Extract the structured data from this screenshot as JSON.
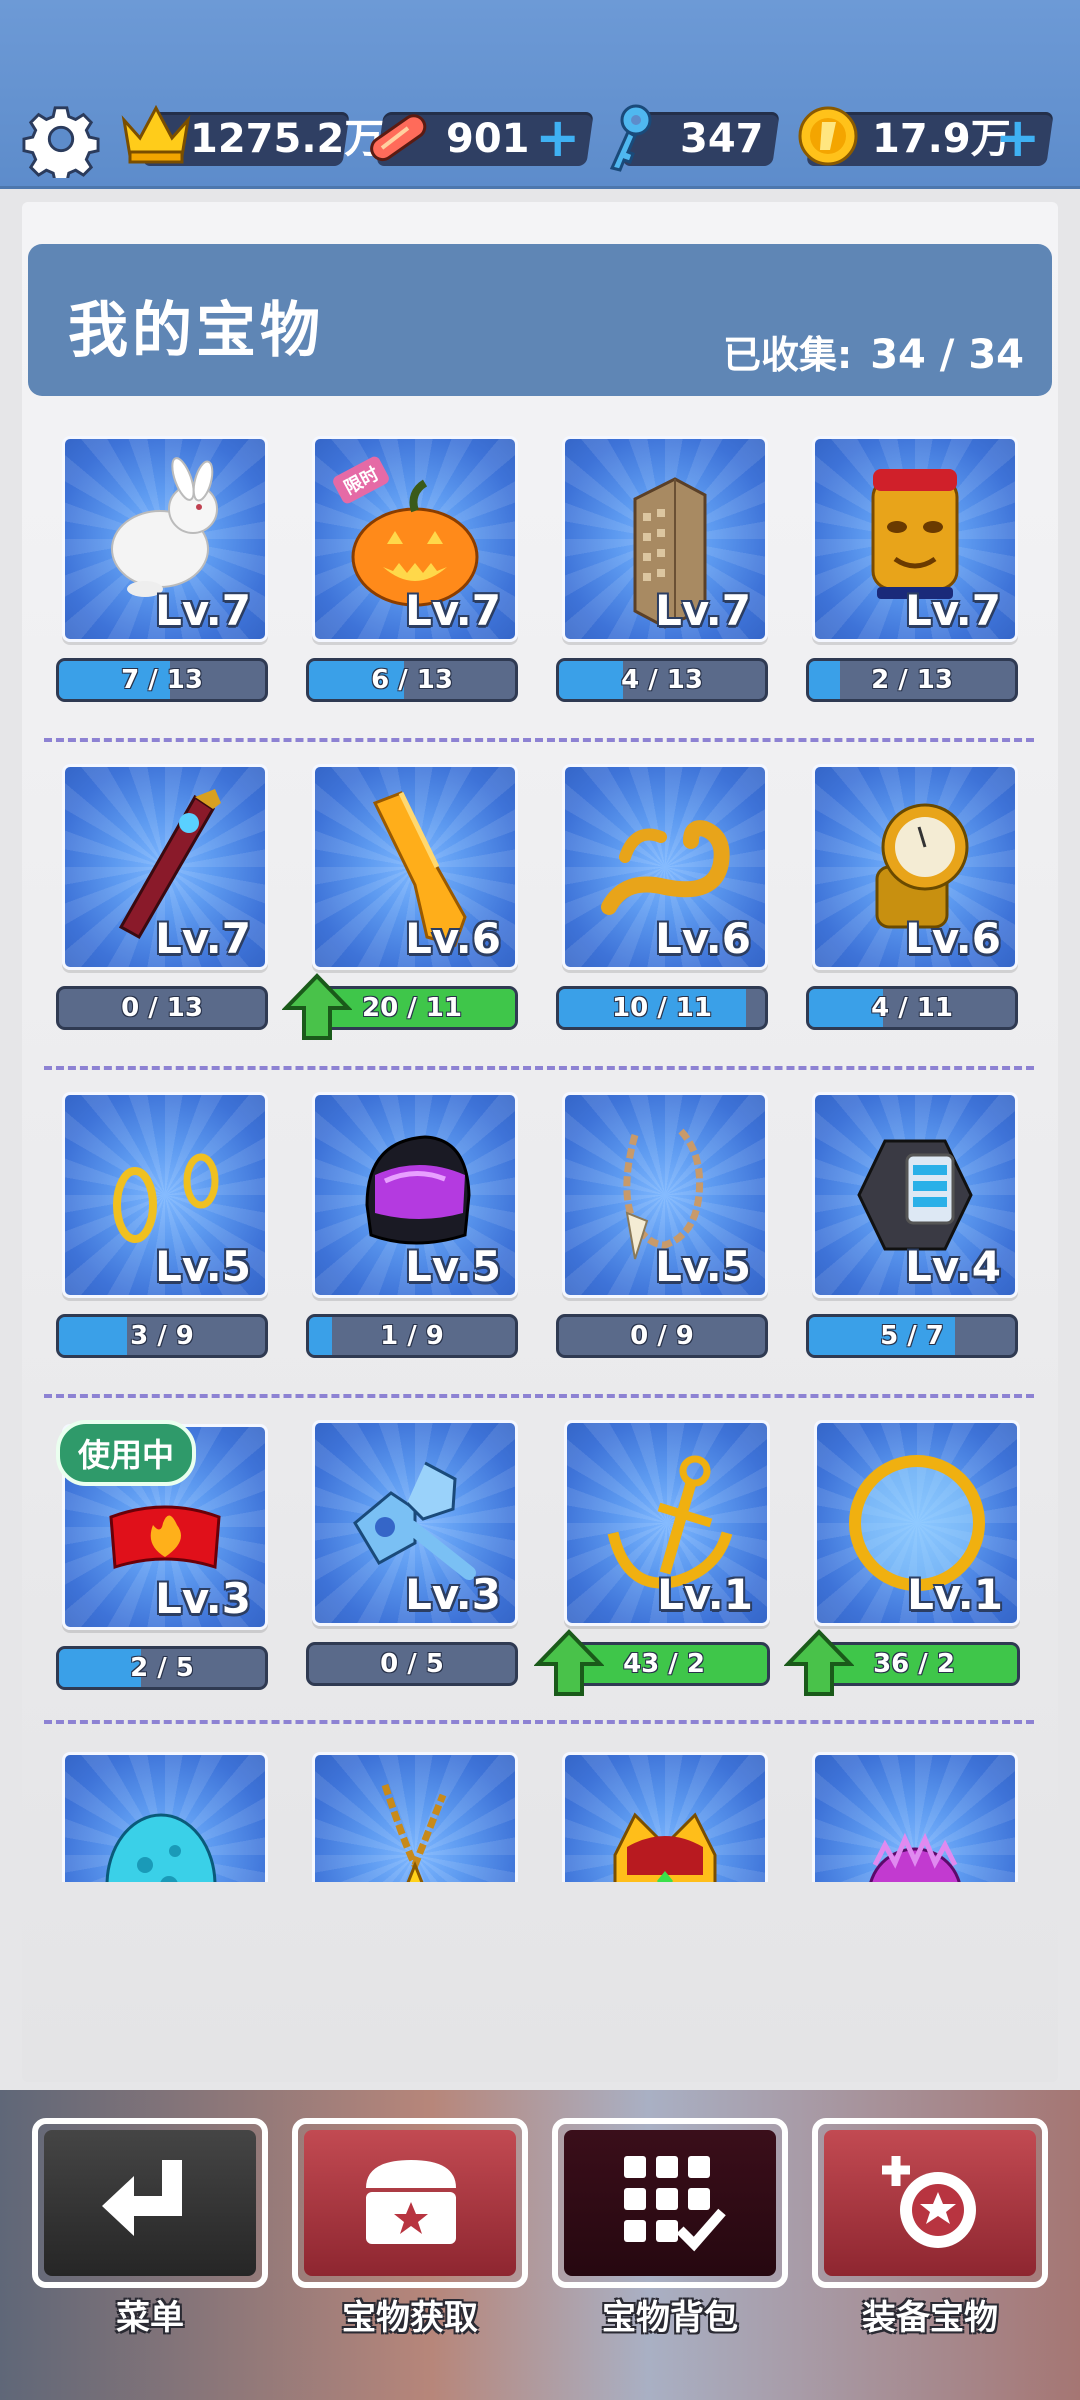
{
  "topbar": {
    "crown_value": "1275.2万",
    "board_value": "901",
    "key_value": "347",
    "coin_value": "17.9万",
    "plus": "+"
  },
  "header": {
    "title": "我的宝物",
    "collected_label": "已收集:",
    "collected_value": "34 / 34"
  },
  "items": [
    {
      "icon": "rabbit-icon",
      "level": "Lv.7",
      "progress": "7 / 13",
      "fill": 0.54,
      "full": false
    },
    {
      "icon": "pumpkin-icon",
      "level": "Lv.7",
      "progress": "6 / 13",
      "fill": 0.46,
      "full": false,
      "limited": "限时"
    },
    {
      "icon": "skyscraper-icon",
      "level": "Lv.7",
      "progress": "4 / 13",
      "fill": 0.31,
      "full": false
    },
    {
      "icon": "golden-mask-icon",
      "level": "Lv.7",
      "progress": "2 / 13",
      "fill": 0.15,
      "full": false
    },
    {
      "icon": "guitar-icon",
      "level": "Lv.7",
      "progress": "0 / 13",
      "fill": 0,
      "full": false
    },
    {
      "icon": "golden-board-icon",
      "level": "Lv.6",
      "progress": "20 / 11",
      "fill": 1,
      "full": true
    },
    {
      "icon": "golden-horn-icon",
      "level": "Lv.6",
      "progress": "10 / 11",
      "fill": 0.91,
      "full": false
    },
    {
      "icon": "golden-watch-icon",
      "level": "Lv.6",
      "progress": "4 / 11",
      "fill": 0.36,
      "full": false
    },
    {
      "icon": "gold-rings-icon",
      "level": "Lv.5",
      "progress": "3 / 9",
      "fill": 0.33,
      "full": false
    },
    {
      "icon": "helmet-icon",
      "level": "Lv.5",
      "progress": "1 / 9",
      "fill": 0.11,
      "full": false
    },
    {
      "icon": "tooth-necklace-icon",
      "level": "Lv.5",
      "progress": "0 / 9",
      "fill": 0,
      "full": false
    },
    {
      "icon": "hex-gadget-icon",
      "level": "Lv.4",
      "progress": "5 / 7",
      "fill": 0.71,
      "full": false
    },
    {
      "icon": "fire-headband-icon",
      "level": "Lv.3",
      "progress": "2 / 5",
      "fill": 0.4,
      "full": false,
      "in_use": "使用中"
    },
    {
      "icon": "wrench-icon",
      "level": "Lv.3",
      "progress": "0 / 5",
      "fill": 0,
      "full": false
    },
    {
      "icon": "anchor-icon",
      "level": "Lv.1",
      "progress": "43 / 2",
      "fill": 1,
      "full": true
    },
    {
      "icon": "halo-icon",
      "level": "Lv.1",
      "progress": "36 / 2",
      "fill": 1,
      "full": true
    },
    {
      "icon": "spotted-egg-icon"
    },
    {
      "icon": "star-necklace-icon"
    },
    {
      "icon": "crown-icon"
    },
    {
      "icon": "purple-flower-icon"
    }
  ],
  "nav": {
    "menu": "菜单",
    "treasure_get": "宝物获取",
    "treasure_bag": "宝物背包",
    "equip_treasure": "装备宝物"
  },
  "colors": {
    "topbar": "#5d8ccb",
    "header": "#5f86b5",
    "bar_fill": "#3aa0e8",
    "bar_full": "#3fc64a",
    "divider": "#8d82d3"
  }
}
